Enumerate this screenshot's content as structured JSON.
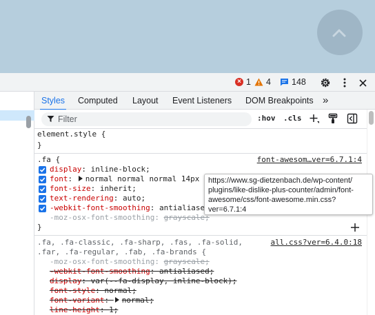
{
  "status": {
    "errors": "1",
    "warnings": "4",
    "messages": "148"
  },
  "tabs": [
    {
      "label": "Styles",
      "active": true
    },
    {
      "label": "Computed"
    },
    {
      "label": "Layout"
    },
    {
      "label": "Event Listeners"
    },
    {
      "label": "DOM Breakpoints"
    },
    {
      "label": "»"
    }
  ],
  "filter": {
    "placeholder": "Filter",
    "hov_label": ":hov",
    "cls_label": ".cls"
  },
  "rules": {
    "element_style": {
      "selector": "element.style {",
      "close": "}"
    },
    "fa": {
      "selector": ".fa {",
      "source": "font-awesom…ver=6.7.1:4",
      "declarations": [
        {
          "prop": "display",
          "value": "inline-block;"
        },
        {
          "prop": "font",
          "value": "normal normal normal 14px"
        },
        {
          "prop": "font-size",
          "value": "inherit;"
        },
        {
          "prop": "text-rendering",
          "value": "auto;"
        },
        {
          "prop": "-webkit-font-smoothing",
          "value": "antialiased"
        },
        {
          "prop": "-moz-osx-font-smoothing",
          "value": "grayscale;"
        }
      ],
      "close": "}"
    },
    "fa_classic": {
      "selector_line1": ".fa, .fa-classic, .fa-sharp, .fas, .fa-solid,",
      "selector_line2": ".far, .fa-regular, .fab, .fa-brands {",
      "source": "all.css?ver=6.4.0:18",
      "declarations": [
        {
          "prop": "-moz-osx-font-smoothing",
          "value": "grayscale;"
        },
        {
          "prop": "-webkit-font-smoothing",
          "value": "antialiased;"
        },
        {
          "prop": "display",
          "value": "var(--fa-display, inline-block);"
        },
        {
          "prop": "font-style",
          "value": "normal;"
        },
        {
          "prop": "font-variant",
          "value": "normal;"
        },
        {
          "prop": "line-height",
          "value": "1;"
        }
      ]
    }
  },
  "tooltip": {
    "line1": "https://www.sg-dietzenbach.de/wp-content/",
    "line2": "plugins/like-dislike-plus-counter/admin/font-",
    "line3": "awesome/css/font-awesome.min.css?",
    "line4": "ver=6.7.1:4"
  },
  "colors": {
    "accent": "#1a73e8",
    "property": "#c80000",
    "error": "#d93025",
    "warning": "#e37400"
  },
  "icons": [
    "chevron-up-icon",
    "error-icon",
    "warning-icon",
    "message-icon",
    "gear-icon",
    "more-vert-icon",
    "close-icon",
    "filter-icon",
    "add-icon",
    "paint-brush-icon",
    "sidebar-toggle-icon",
    "checkbox-icon"
  ]
}
